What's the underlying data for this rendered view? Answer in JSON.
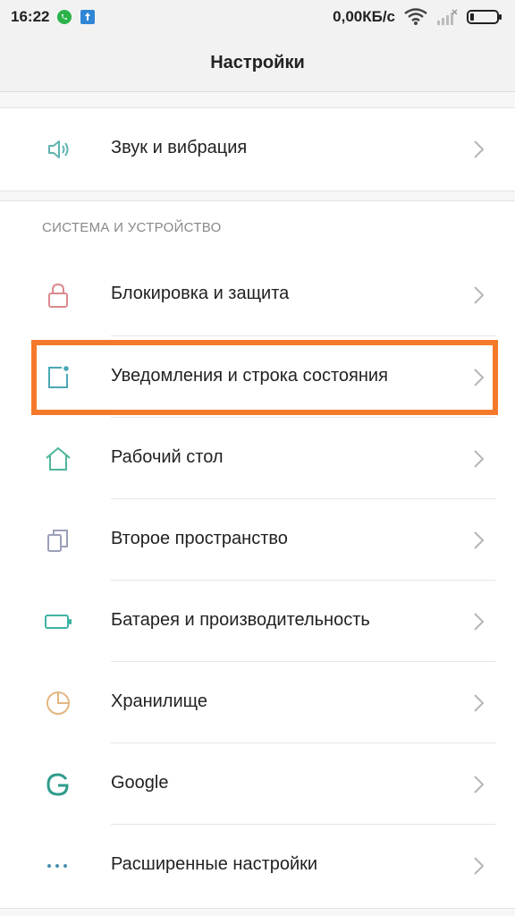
{
  "status_bar": {
    "time": "16:22",
    "network_speed": "0,00КБ/с",
    "icons": [
      "whatsapp-icon",
      "notification-icon",
      "wifi-icon",
      "signal-icon",
      "battery-icon"
    ]
  },
  "header": {
    "title": "Настройки"
  },
  "top_card": {
    "items": [
      {
        "label": "Звук и вибрация",
        "icon": "speaker-icon",
        "color": "#5fb3b0"
      }
    ]
  },
  "system_section": {
    "title": "СИСТЕМА И УСТРОЙСТВО",
    "items": [
      {
        "label": "Блокировка и защита",
        "icon": "lock-icon",
        "color": "#d98a8e"
      },
      {
        "label": "Уведомления и строка состояния",
        "icon": "notification-square-icon",
        "color": "#4aa7b5",
        "highlighted": true
      },
      {
        "label": "Рабочий стол",
        "icon": "home-icon",
        "color": "#4db59b"
      },
      {
        "label": "Второе пространство",
        "icon": "second-space-icon",
        "color": "#9aa0b8"
      },
      {
        "label": "Батарея и производительность",
        "icon": "battery-icon",
        "color": "#3fb3a3"
      },
      {
        "label": "Хранилище",
        "icon": "storage-pie-icon",
        "color": "#e2b680"
      },
      {
        "label": "Google",
        "icon": "google-icon",
        "color": "#2f9c8c"
      },
      {
        "label": "Расширенные настройки",
        "icon": "more-dots-icon",
        "color": "#4a8fb0"
      }
    ]
  },
  "colors": {
    "highlight": "#f5792a",
    "chevron": "#b5b5b5"
  }
}
